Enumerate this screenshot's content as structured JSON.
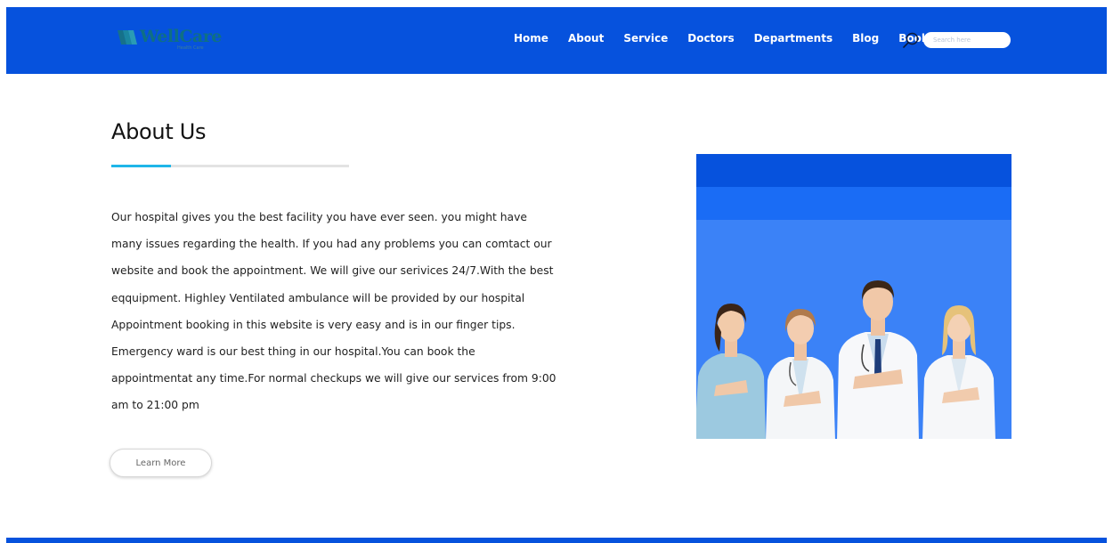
{
  "header": {
    "logo": {
      "name": "WellCare",
      "tagline": "Health Care"
    },
    "nav": [
      {
        "label": "Home"
      },
      {
        "label": "About"
      },
      {
        "label": "Service"
      },
      {
        "label": "Doctors"
      },
      {
        "label": "Departments"
      },
      {
        "label": "Blog"
      },
      {
        "label": "Book"
      }
    ],
    "search": {
      "icon": "search-icon",
      "placeholder": "Search here"
    }
  },
  "about": {
    "title": "About Us",
    "underline_accent_fraction": 0.25,
    "paragraph": "Our hospital gives you the best facility you have ever seen. you might have many issues regarding the health. If you had any problems you can comtact our website and book the appointment. We will give our serivices 24/7.With the best eqquipment. Highley Ventilated ambulance will be provided by our hospital Appointment booking in this website is very easy and is in our finger tips. Emergency ward is our best thing in our hospital.You can book the appointmentat any time.For normal checkups we will give our services from 9:00 am to 21:00 pm",
    "button_label": "Learn More"
  },
  "image": {
    "subject": "doctors-group-image"
  },
  "colors": {
    "primary": "#0652dd",
    "accent": "#1fb6e8",
    "panel": "#3b82f7"
  }
}
